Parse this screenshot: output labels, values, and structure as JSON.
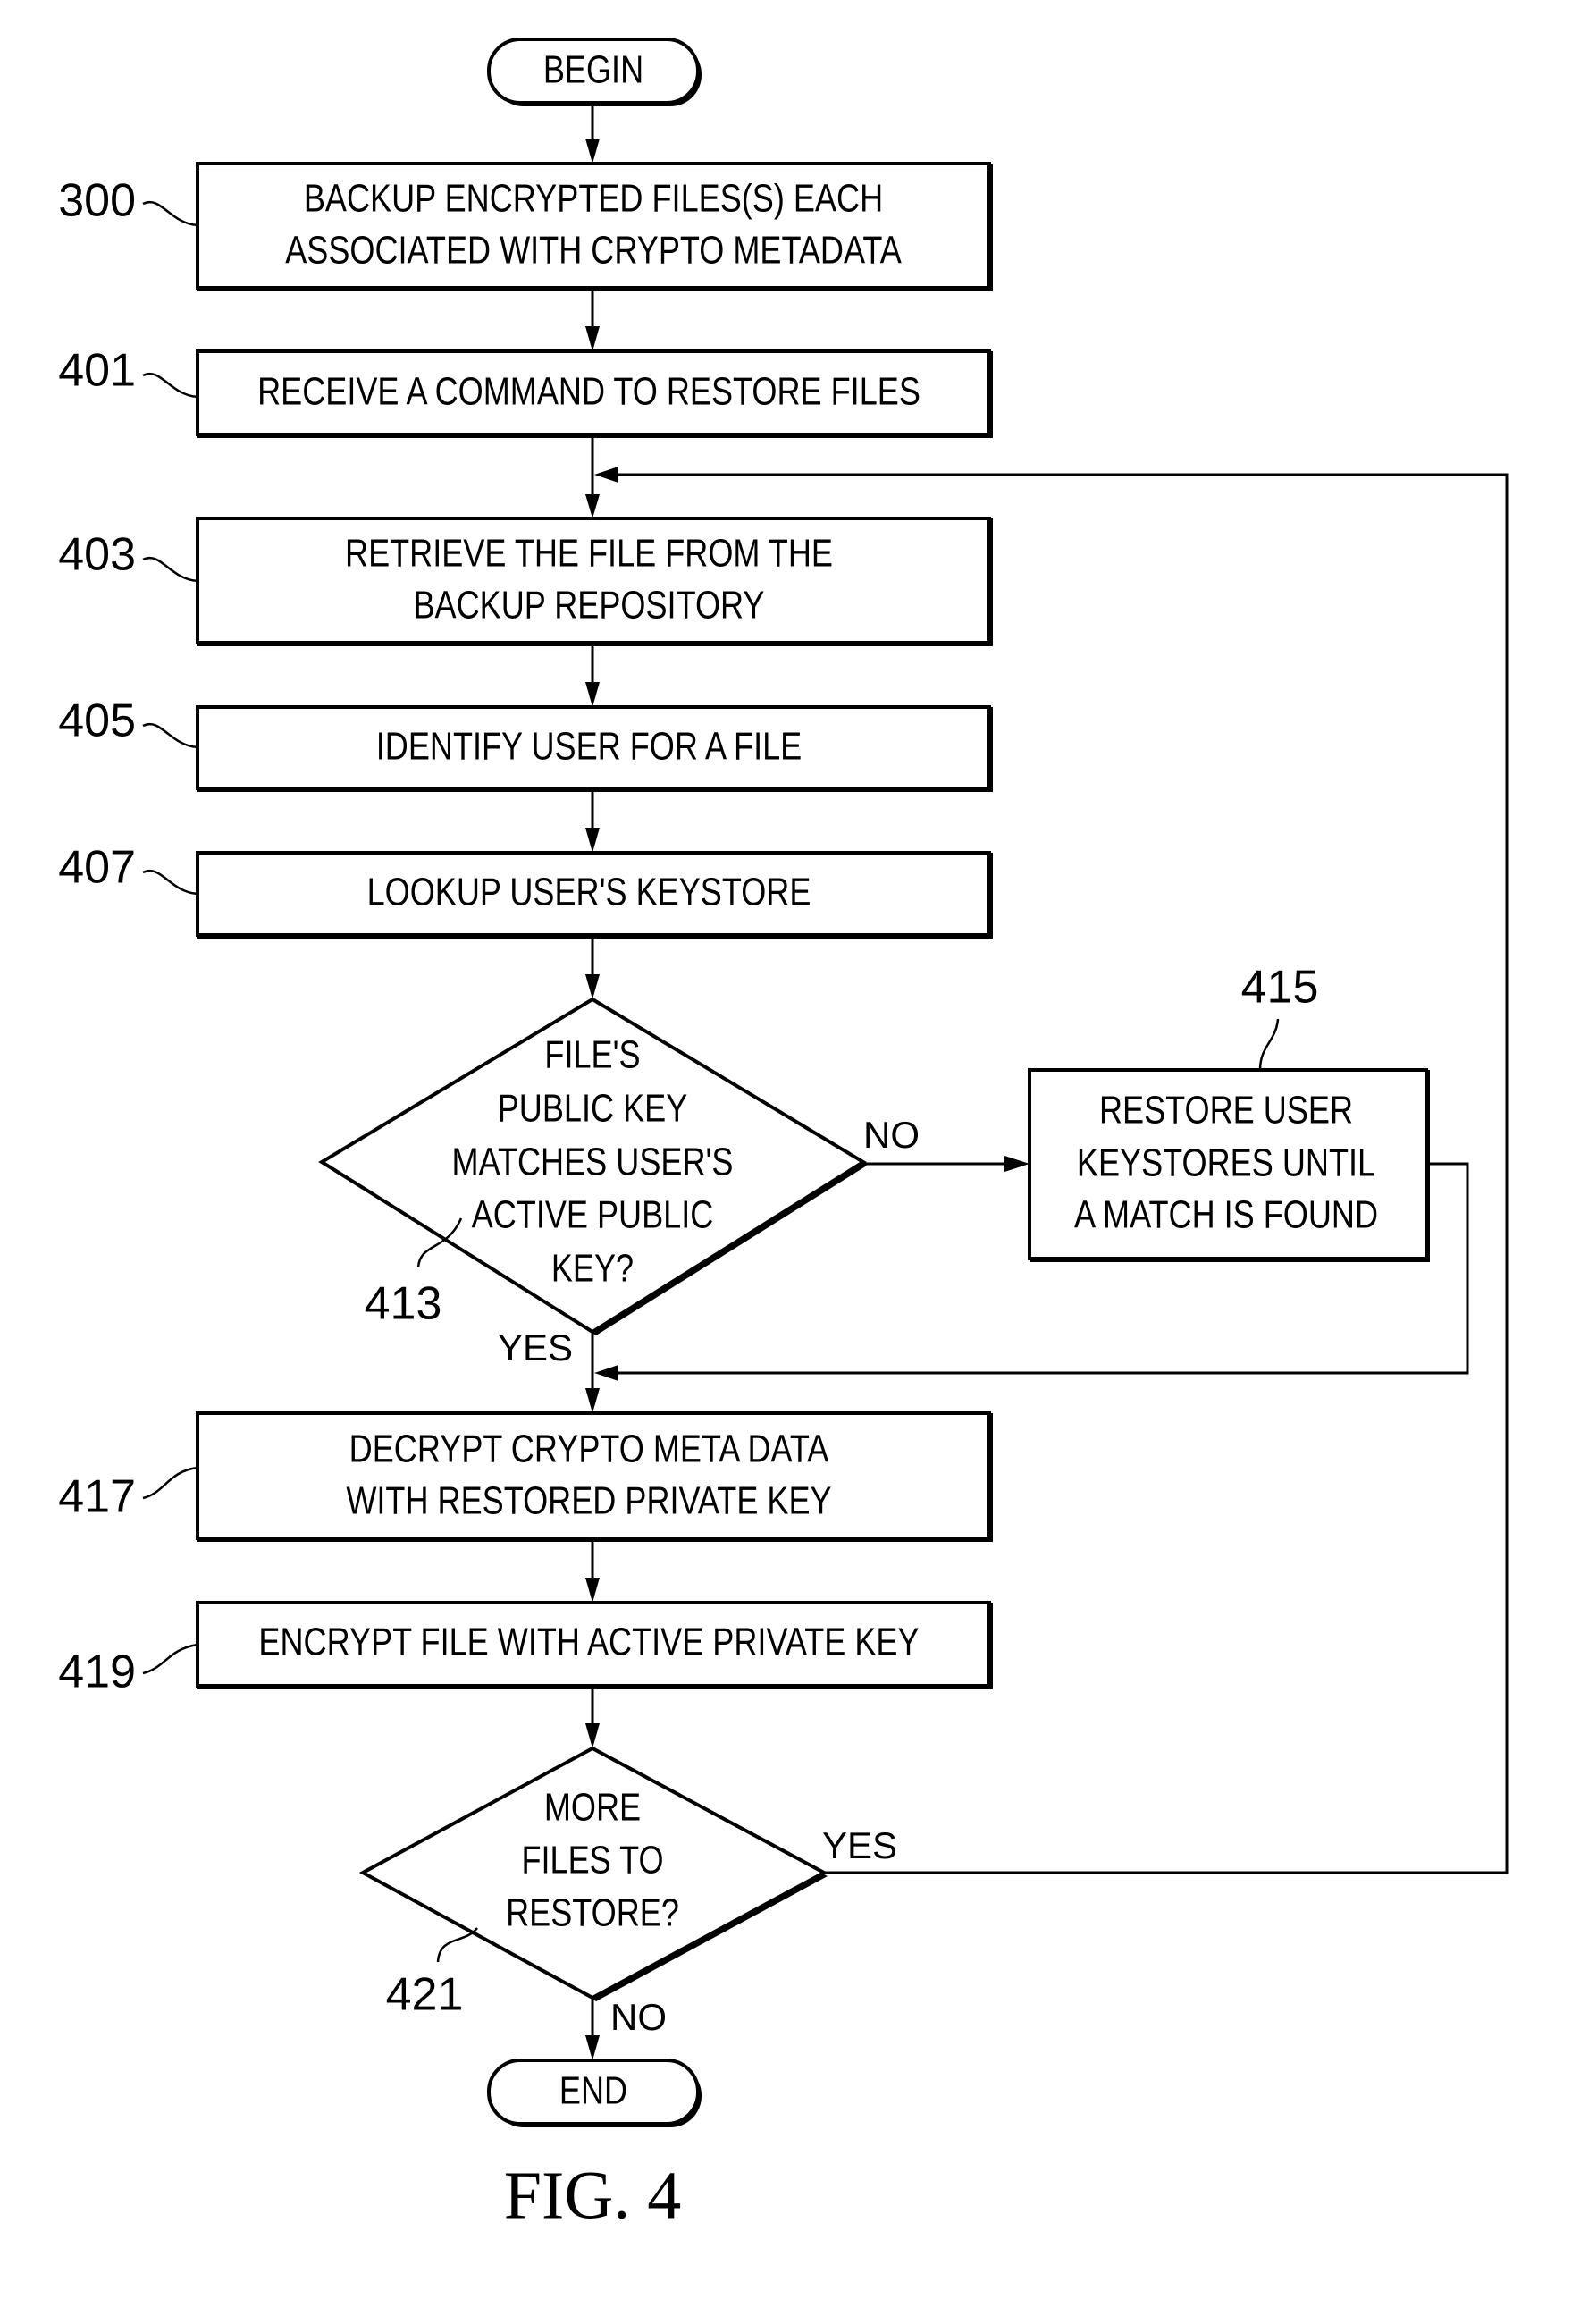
{
  "figure": {
    "caption": "FIG. 4",
    "terminals": {
      "begin": "BEGIN",
      "end": "END"
    },
    "steps": [
      {
        "ref": "300",
        "lines": [
          "BACKUP ENCRYPTED FILES(S) EACH",
          "ASSOCIATED WITH CRYPTO METADATA"
        ]
      },
      {
        "ref": "401",
        "lines": [
          "RECEIVE A COMMAND TO RESTORE FILES"
        ]
      },
      {
        "ref": "403",
        "lines": [
          "RETRIEVE THE FILE FROM THE",
          "BACKUP REPOSITORY"
        ]
      },
      {
        "ref": "405",
        "lines": [
          "IDENTIFY USER FOR A FILE"
        ]
      },
      {
        "ref": "407",
        "lines": [
          "LOOKUP USER'S KEYSTORE"
        ]
      },
      {
        "ref": "415",
        "lines": [
          "RESTORE USER",
          "KEYSTORES UNTIL",
          "A MATCH IS FOUND"
        ]
      },
      {
        "ref": "417",
        "lines": [
          "DECRYPT CRYPTO META DATA",
          "WITH RESTORED PRIVATE KEY"
        ]
      },
      {
        "ref": "419",
        "lines": [
          "ENCRYPT FILE WITH ACTIVE PRIVATE KEY"
        ]
      }
    ],
    "decisions": [
      {
        "ref": "413",
        "lines": [
          "FILE'S",
          "PUBLIC KEY",
          "MATCHES USER'S",
          "ACTIVE PUBLIC",
          "KEY?"
        ],
        "yes_label": "YES",
        "no_label": "NO"
      },
      {
        "ref": "421",
        "lines": [
          "MORE",
          "FILES TO",
          "RESTORE?"
        ],
        "yes_label": "YES",
        "no_label": "NO"
      }
    ]
  }
}
